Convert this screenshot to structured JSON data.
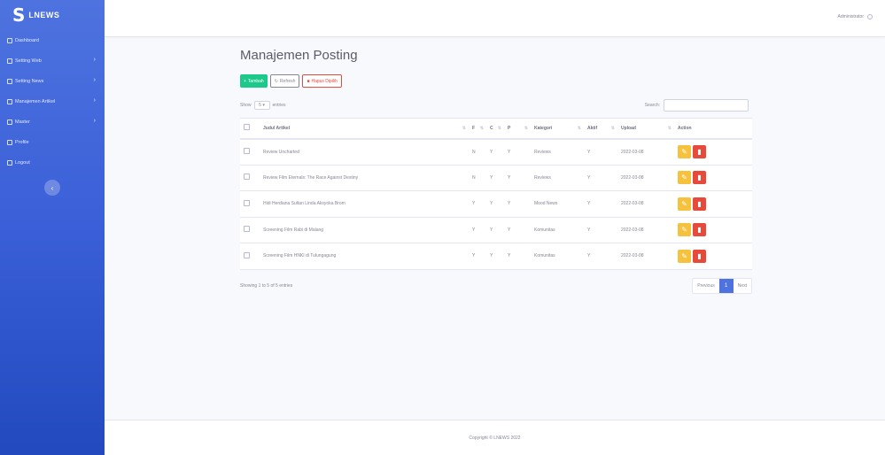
{
  "brand": {
    "logo": "S",
    "name": "LNEWS"
  },
  "sidebar": {
    "items": [
      {
        "label": "Dashboard",
        "has_caret": false
      },
      {
        "label": "Setting Web",
        "has_caret": true
      },
      {
        "label": "Setting News",
        "has_caret": true
      },
      {
        "label": "Manajemen Artikel",
        "has_caret": true
      },
      {
        "label": "Master",
        "has_caret": true
      },
      {
        "label": "Profile",
        "has_caret": false
      },
      {
        "label": "Logout",
        "has_caret": false
      }
    ],
    "toggle_icon": "chevron-left-icon"
  },
  "topbar": {
    "user_name": "Administrator"
  },
  "page": {
    "title": "Manajemen Posting",
    "buttons": {
      "add": "Tambah",
      "refresh": "Refresh",
      "delete_selected": "Hapus Dipilih"
    },
    "show_prefix": "Show",
    "show_value": "5",
    "show_suffix": "entries",
    "search_label": "Search:",
    "search_value": ""
  },
  "table": {
    "headers": [
      "",
      "Judul Artikel",
      "F",
      "C",
      "P",
      "Kategori",
      "Aktif",
      "Upload",
      "Action"
    ],
    "rows": [
      {
        "title": "Review Uncharted",
        "f": "N",
        "c": "Y",
        "p": "Y",
        "kategori": "Reviews",
        "aktif": "Y",
        "upload": "2022-03-08"
      },
      {
        "title": "Review Film Eternals: The Race Against Destiny",
        "f": "N",
        "c": "Y",
        "p": "Y",
        "kategori": "Reviews",
        "aktif": "Y",
        "upload": "2022-03-08"
      },
      {
        "title": "Hidi Herdiana Sultan Linda Aksyoka Brom",
        "f": "Y",
        "c": "Y",
        "p": "Y",
        "kategori": "Mood News",
        "aktif": "Y",
        "upload": "2022-03-08"
      },
      {
        "title": "Screening Film Rabi di Malang",
        "f": "Y",
        "c": "Y",
        "p": "Y",
        "kategori": "Komunitas",
        "aktif": "Y",
        "upload": "2022-03-08"
      },
      {
        "title": "Screening Film HNKI di Tulungagung",
        "f": "Y",
        "c": "Y",
        "p": "Y",
        "kategori": "Komunitas",
        "aktif": "Y",
        "upload": "2022-03-08"
      }
    ]
  },
  "pagination": {
    "info": "Showing 1 to 5 of 5 entries",
    "previous": "Previous",
    "current": "1",
    "next": "Next"
  },
  "footer": {
    "text": "Copyright © LNEWS 2022"
  },
  "colors": {
    "sidebar": "#4e73df",
    "success": "#1cc88a",
    "danger": "#e74a3b",
    "warning": "#f6c23e",
    "primary": "#4e73df"
  }
}
